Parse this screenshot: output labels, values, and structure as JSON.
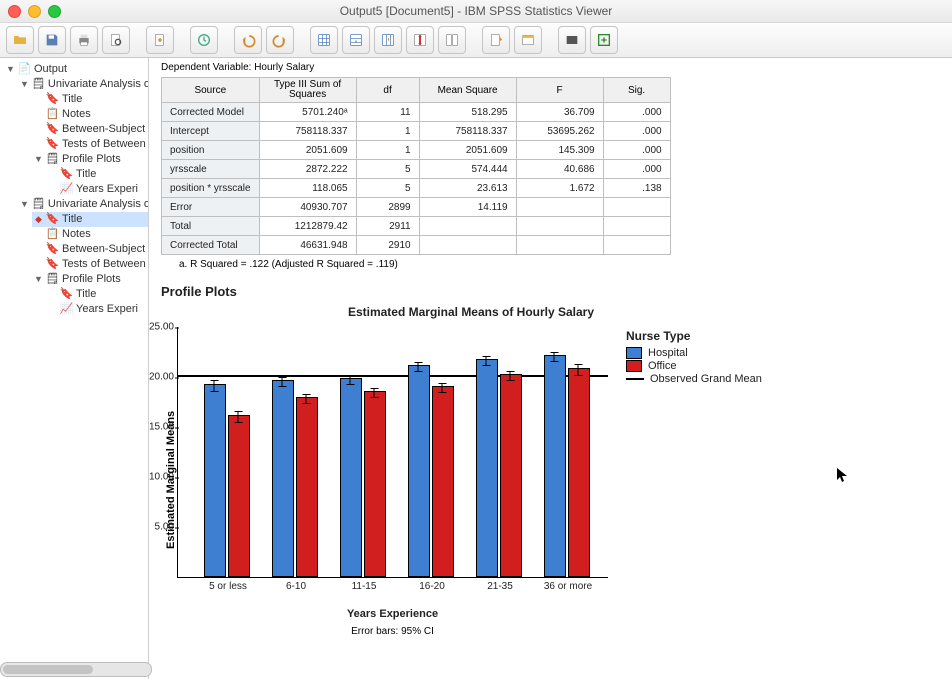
{
  "window": {
    "title": "Output5 [Document5] - IBM SPSS Statistics Viewer"
  },
  "tree": {
    "root": "Output",
    "ua": "Univariate Analysis of",
    "title": "Title",
    "notes": "Notes",
    "between": "Between-Subject",
    "tests": "Tests of Between",
    "profile": "Profile Plots",
    "years": "Years Experi"
  },
  "table": {
    "dv_label": "Dependent Variable:   Hourly Salary",
    "h_source": "Source",
    "h_ss": "Type III Sum of Squares",
    "h_df": "df",
    "h_ms": "Mean Square",
    "h_f": "F",
    "h_sig": "Sig.",
    "rows": [
      {
        "src": "Corrected Model",
        "ss": "5701.240ᵃ",
        "df": "11",
        "ms": "518.295",
        "f": "36.709",
        "sig": ".000"
      },
      {
        "src": "Intercept",
        "ss": "758118.337",
        "df": "1",
        "ms": "758118.337",
        "f": "53695.262",
        "sig": ".000"
      },
      {
        "src": "position",
        "ss": "2051.609",
        "df": "1",
        "ms": "2051.609",
        "f": "145.309",
        "sig": ".000"
      },
      {
        "src": "yrsscale",
        "ss": "2872.222",
        "df": "5",
        "ms": "574.444",
        "f": "40.686",
        "sig": ".000"
      },
      {
        "src": "position * yrsscale",
        "ss": "118.065",
        "df": "5",
        "ms": "23.613",
        "f": "1.672",
        "sig": ".138"
      },
      {
        "src": "Error",
        "ss": "40930.707",
        "df": "2899",
        "ms": "14.119",
        "f": "",
        "sig": ""
      },
      {
        "src": "Total",
        "ss": "1212879.42",
        "df": "2911",
        "ms": "",
        "f": "",
        "sig": ""
      },
      {
        "src": "Corrected Total",
        "ss": "46631.948",
        "df": "2910",
        "ms": "",
        "f": "",
        "sig": ""
      }
    ],
    "footnote": "a. R Squared = .122 (Adjusted R Squared = .119)"
  },
  "section_title": "Profile Plots",
  "chart_data": {
    "type": "bar",
    "title": "Estimated Marginal Means of Hourly Salary",
    "xlabel": "Years Experience",
    "ylabel": "Estimated Marginal Means",
    "categories": [
      "5 or less",
      "6-10",
      "11-15",
      "16-20",
      "21-35",
      "36 or more"
    ],
    "series": [
      {
        "name": "Hospital",
        "values": [
          19.1,
          19.5,
          19.7,
          21.0,
          21.6,
          22.0
        ],
        "err": [
          0.6,
          0.5,
          0.5,
          0.5,
          0.5,
          0.5
        ],
        "color": "#3f7fd1"
      },
      {
        "name": "Office",
        "values": [
          16.0,
          17.8,
          18.4,
          18.9,
          20.1,
          20.7
        ],
        "err": [
          0.6,
          0.5,
          0.5,
          0.5,
          0.5,
          0.6
        ],
        "color": "#d11f1f"
      }
    ],
    "grand_mean_label": "Observed Grand Mean",
    "grand_mean": 20.0,
    "ylim": [
      0,
      25
    ],
    "yticks": [
      5.0,
      10.0,
      15.0,
      20.0,
      25.0
    ],
    "error_bar_note": "Error bars: 95% CI",
    "legend_title": "Nurse Type"
  }
}
